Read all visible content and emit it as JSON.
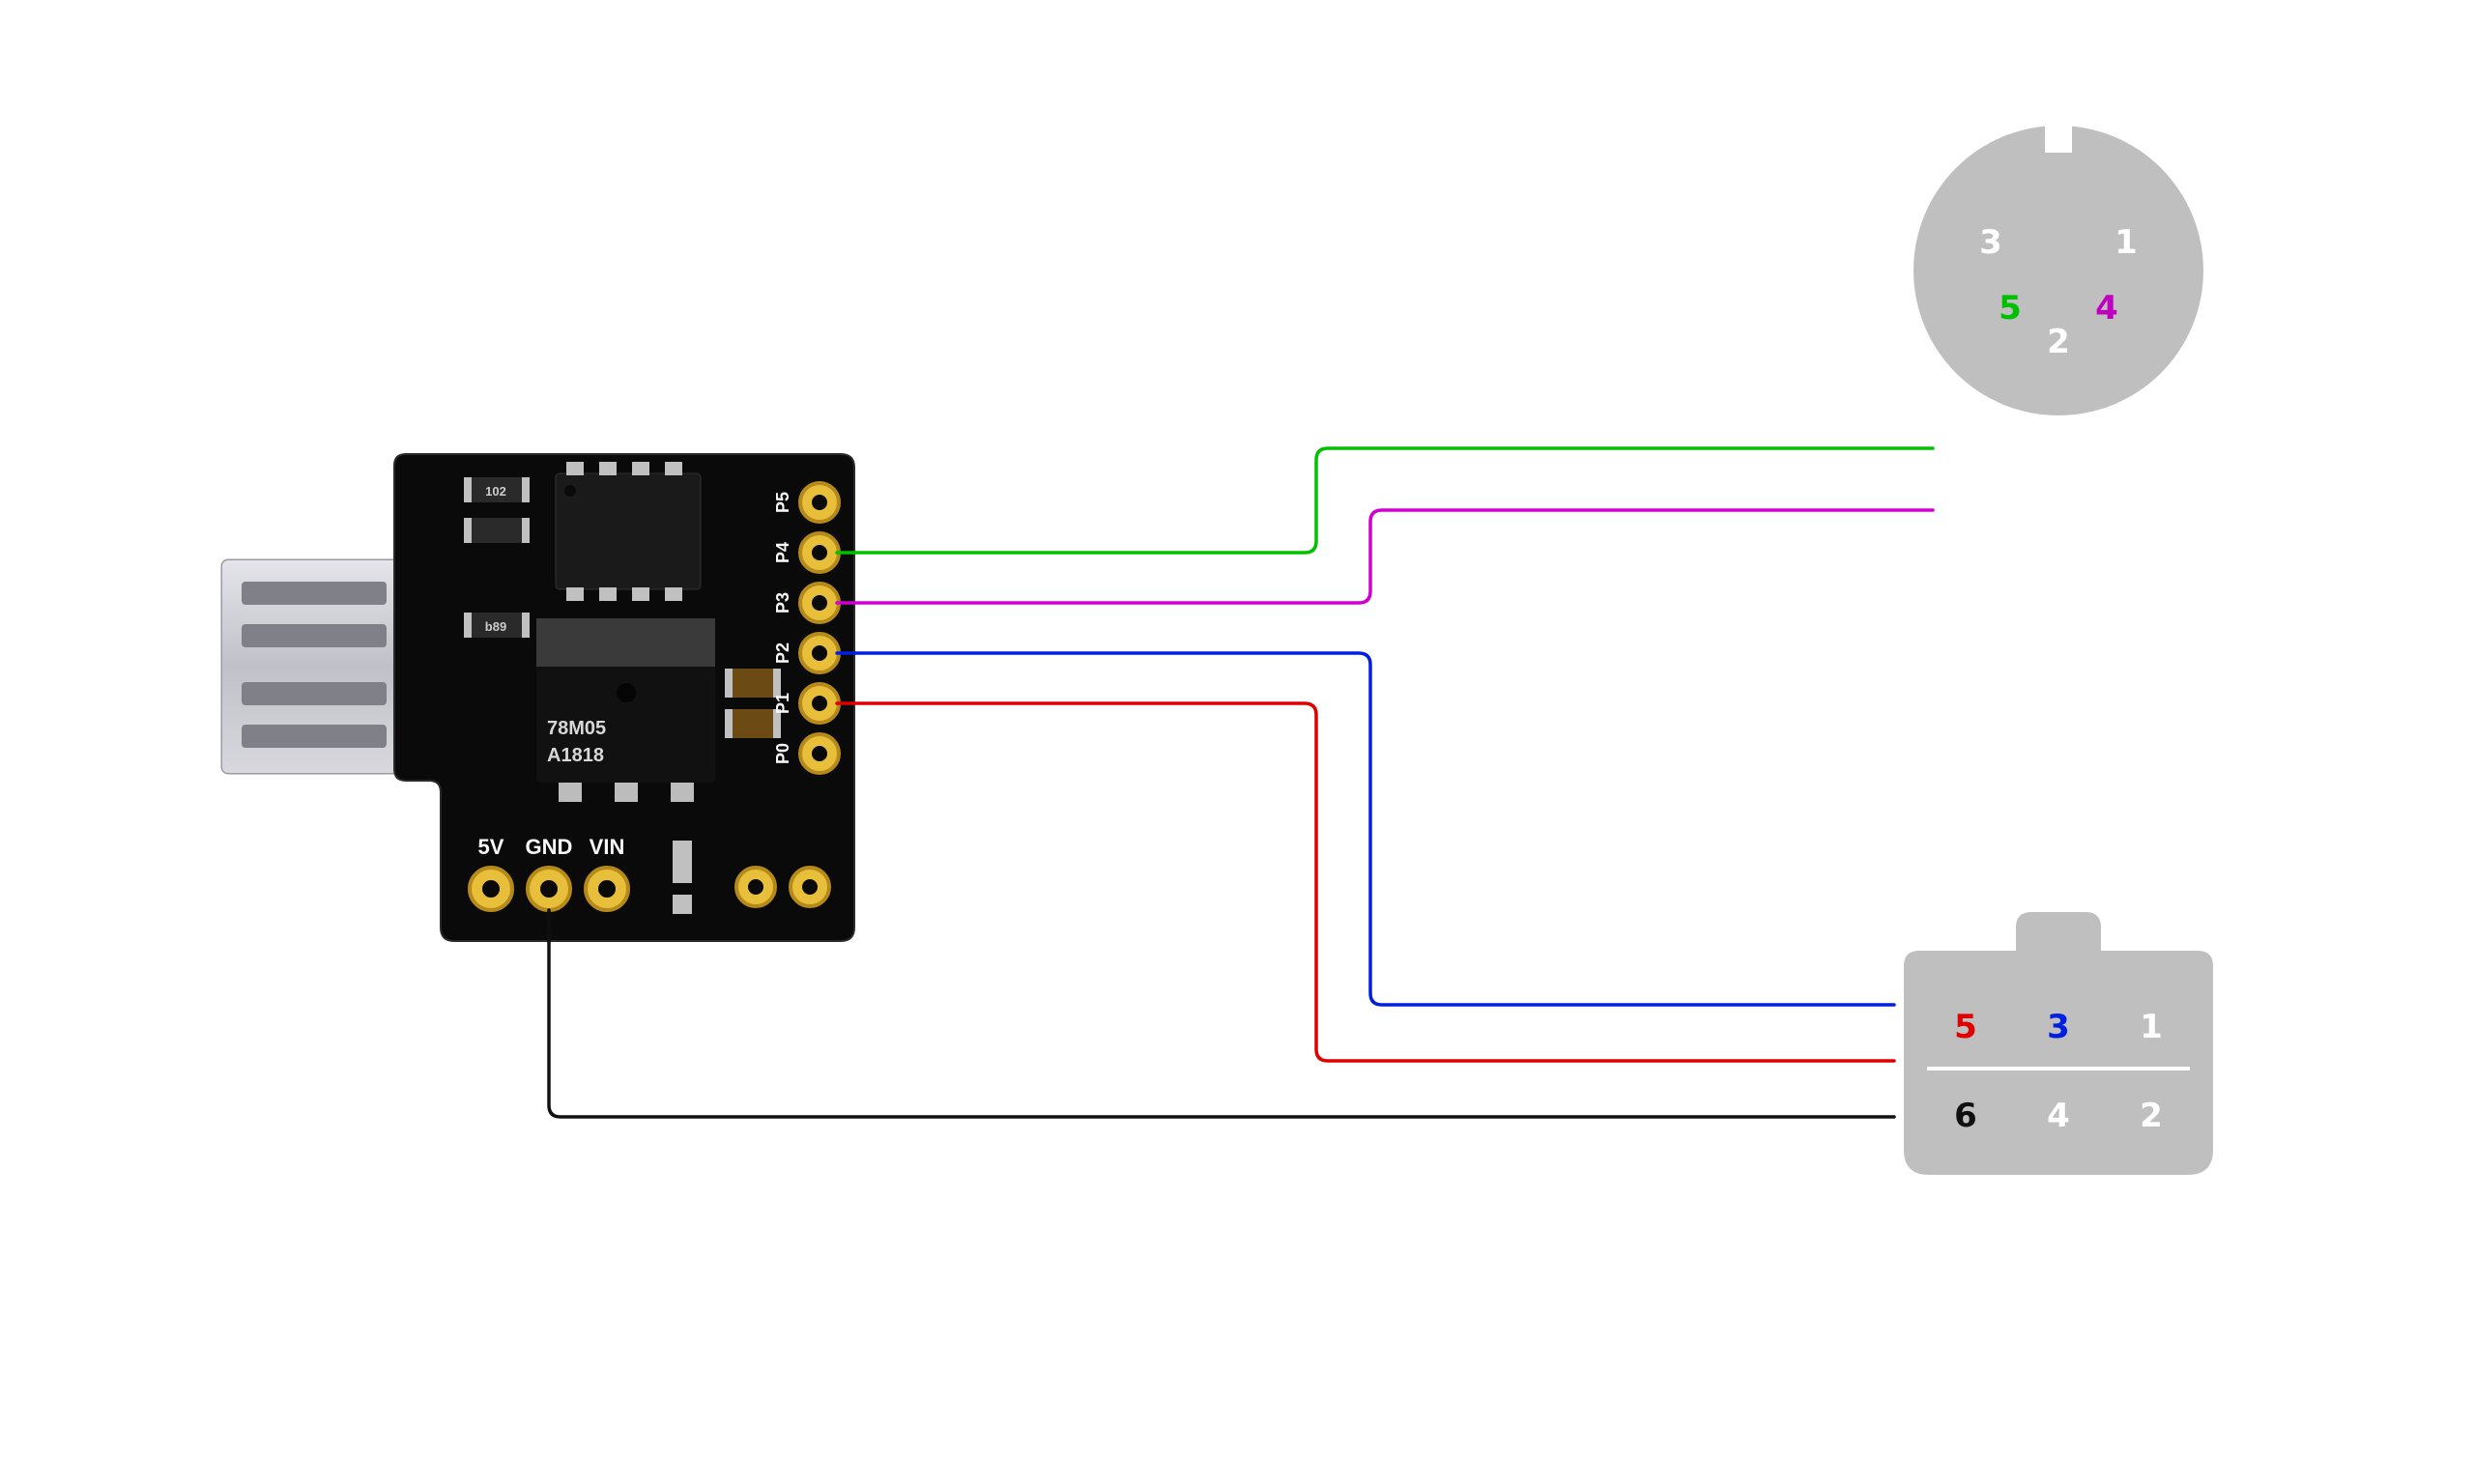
{
  "board": {
    "power_labels": {
      "v5": "5V",
      "gnd": "GND",
      "vin": "VIN"
    },
    "io_labels": {
      "p0": "P0",
      "p1": "P1",
      "p2": "P2",
      "p3": "P3",
      "p4": "P4",
      "p5": "P5"
    },
    "ic_marking_top": "78M05",
    "ic_marking_bottom": "A1818"
  },
  "din_connector": {
    "pins": {
      "p1": "1",
      "p2": "2",
      "p3": "3",
      "p4": "4",
      "p5": "5"
    }
  },
  "rect_connector": {
    "pins": {
      "p1": "1",
      "p2": "2",
      "p3": "3",
      "p4": "4",
      "p5": "5",
      "p6": "6"
    }
  },
  "wires": {
    "green": {
      "from_board_pin": "P4",
      "to": "din.5",
      "color": "#00c000"
    },
    "magenta": {
      "from_board_pin": "P3",
      "to": "din.4",
      "color": "#d000d0"
    },
    "blue": {
      "from_board_pin": "P2",
      "to": "rect.3",
      "color": "#0020e0"
    },
    "red": {
      "from_board_pin": "P1",
      "to": "rect.5",
      "color": "#e00000"
    },
    "black": {
      "from_board_pin": "GND",
      "to": "rect.6",
      "color": "#101010"
    }
  },
  "colors": {
    "connector_grey": "#bfbfbf",
    "pcb_black": "#0a0a0a",
    "pad_gold": "#e7bf3a",
    "pad_gold_dark": "#b58a1a",
    "usb_silver": "#c8c8ce"
  }
}
